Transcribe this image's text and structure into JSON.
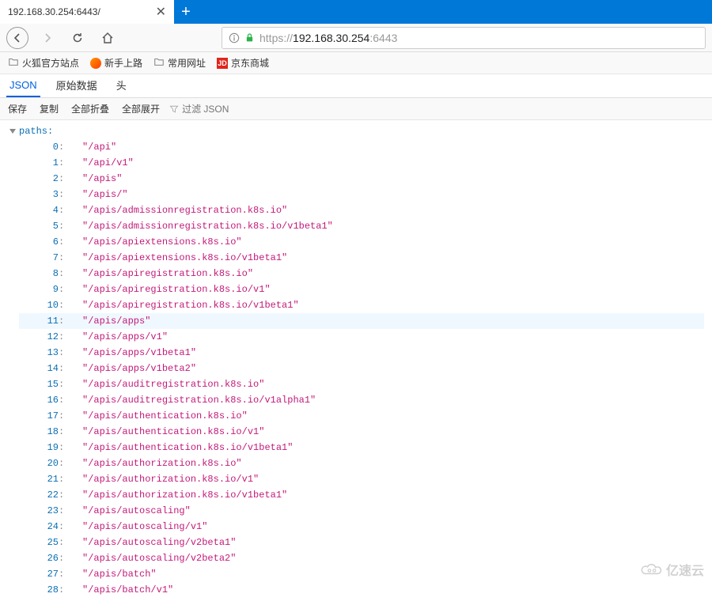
{
  "tab": {
    "title": "192.168.30.254:6443/",
    "close": "✕",
    "newtab": "+"
  },
  "nav": {
    "url_proto": "https://",
    "url_host": "192.168.30.254",
    "url_port": ":6443"
  },
  "bookmarks": {
    "items": [
      {
        "label": "火狐官方站点",
        "icon": "folder"
      },
      {
        "label": "新手上路",
        "icon": "firefox"
      },
      {
        "label": "常用网址",
        "icon": "folder"
      },
      {
        "label": "京东商城",
        "icon": "jd",
        "icon_text": "JD"
      }
    ]
  },
  "json_tabs": {
    "json": "JSON",
    "raw": "原始数据",
    "headers": "头"
  },
  "json_toolbar": {
    "save": "保存",
    "copy": "复制",
    "collapse_all": "全部折叠",
    "expand_all": "全部展开",
    "filter_placeholder": "过滤 JSON"
  },
  "root_key": "paths:",
  "highlight_index": 11,
  "paths": [
    "/api",
    "/api/v1",
    "/apis",
    "/apis/",
    "/apis/admissionregistration.k8s.io",
    "/apis/admissionregistration.k8s.io/v1beta1",
    "/apis/apiextensions.k8s.io",
    "/apis/apiextensions.k8s.io/v1beta1",
    "/apis/apiregistration.k8s.io",
    "/apis/apiregistration.k8s.io/v1",
    "/apis/apiregistration.k8s.io/v1beta1",
    "/apis/apps",
    "/apis/apps/v1",
    "/apis/apps/v1beta1",
    "/apis/apps/v1beta2",
    "/apis/auditregistration.k8s.io",
    "/apis/auditregistration.k8s.io/v1alpha1",
    "/apis/authentication.k8s.io",
    "/apis/authentication.k8s.io/v1",
    "/apis/authentication.k8s.io/v1beta1",
    "/apis/authorization.k8s.io",
    "/apis/authorization.k8s.io/v1",
    "/apis/authorization.k8s.io/v1beta1",
    "/apis/autoscaling",
    "/apis/autoscaling/v1",
    "/apis/autoscaling/v2beta1",
    "/apis/autoscaling/v2beta2",
    "/apis/batch",
    "/apis/batch/v1"
  ],
  "watermark": "亿速云"
}
